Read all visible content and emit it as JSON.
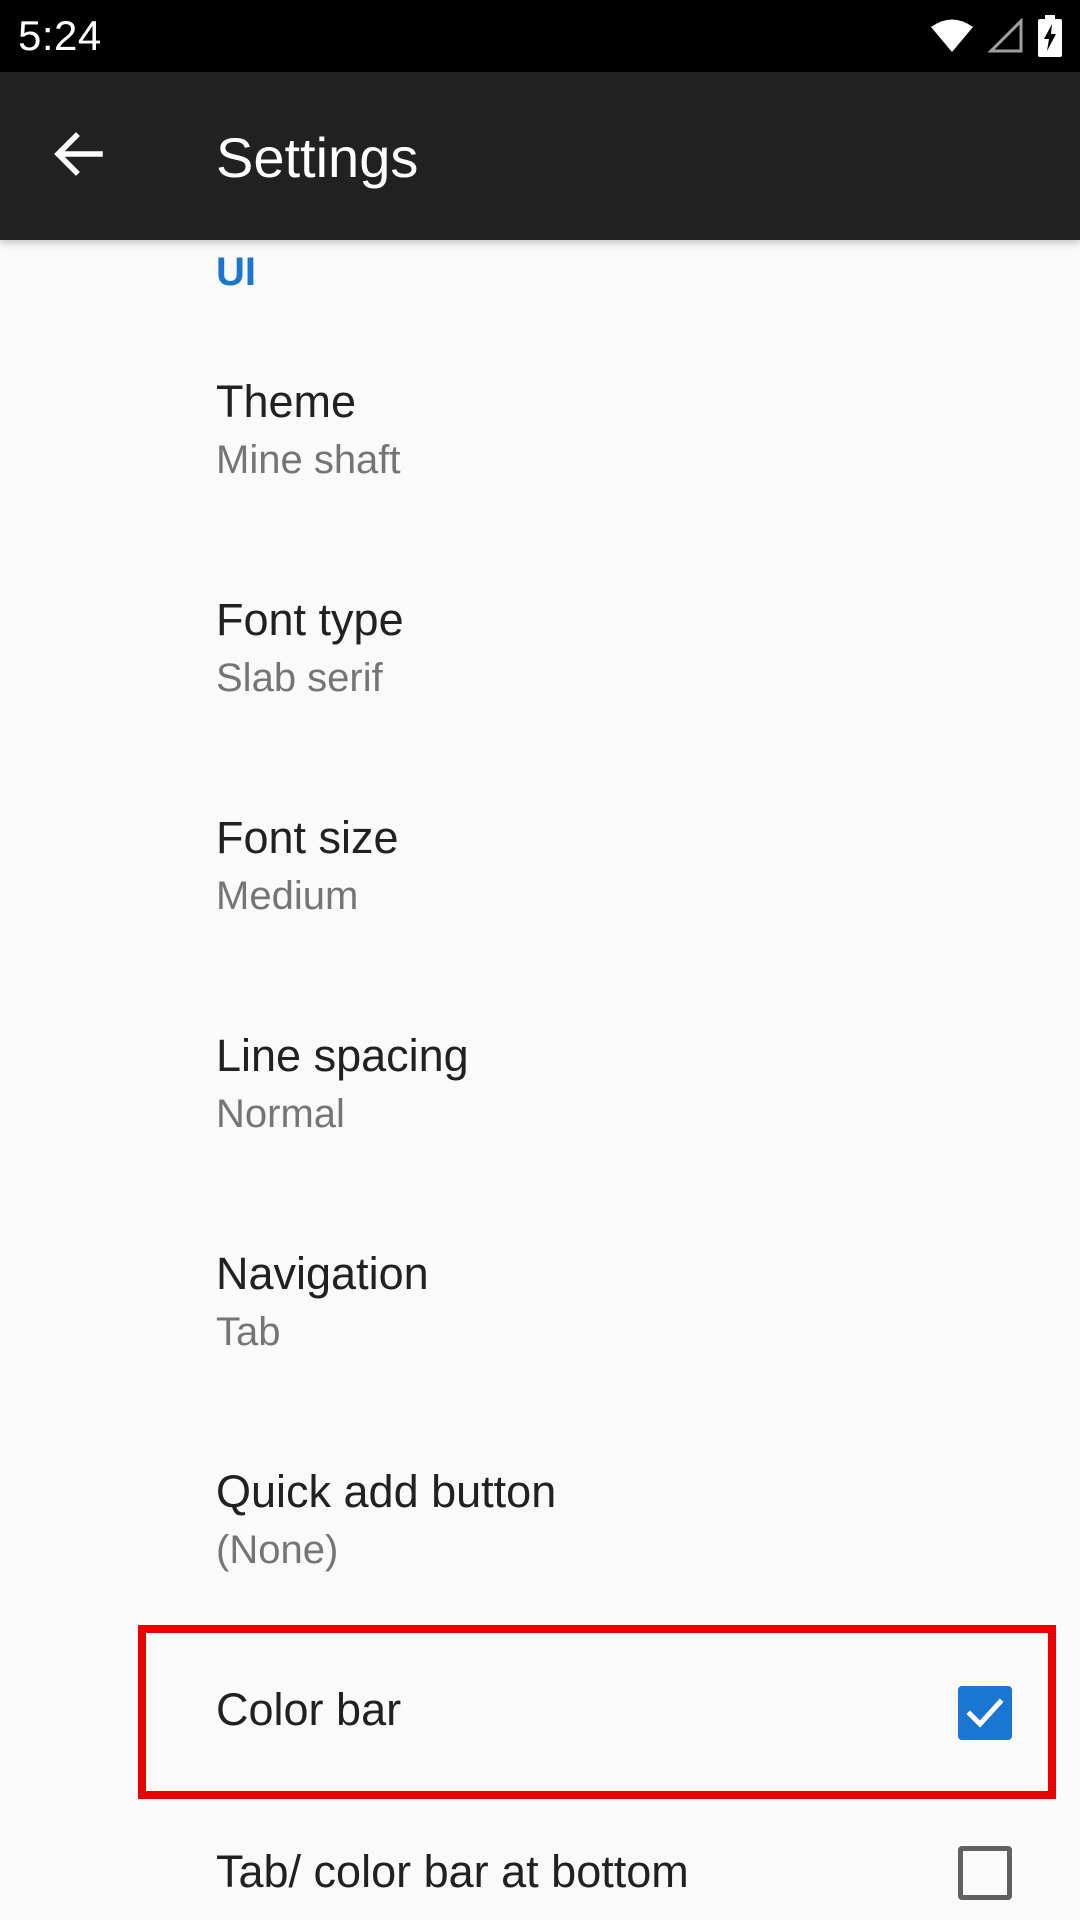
{
  "status_bar": {
    "time": "5:24",
    "icons": [
      "wifi-icon",
      "cellular-signal-icon",
      "battery-charging-icon"
    ]
  },
  "app_bar": {
    "back_icon": "arrow-left-icon",
    "title": "Settings"
  },
  "section": {
    "header": "UI"
  },
  "preferences": [
    {
      "title": "Theme",
      "summary": "Mine shaft"
    },
    {
      "title": "Font type",
      "summary": "Slab serif"
    },
    {
      "title": "Font size",
      "summary": "Medium"
    },
    {
      "title": "Line spacing",
      "summary": "Normal"
    },
    {
      "title": "Navigation",
      "summary": "Tab"
    },
    {
      "title": "Quick add button",
      "summary": "(None)"
    }
  ],
  "checkbox_preferences": [
    {
      "title": "Color bar",
      "checked": true
    },
    {
      "title": "Tab/ color bar at bottom",
      "checked": false
    }
  ],
  "colors": {
    "accent": "#1976d2",
    "app_bar": "#212121",
    "highlight": "#ee0000",
    "background": "#fafafa"
  }
}
